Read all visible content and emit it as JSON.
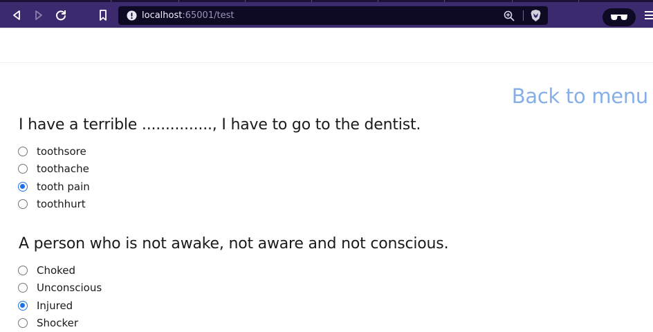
{
  "browser": {
    "url_host": "localhost",
    "url_rest": ":65001/test"
  },
  "page": {
    "back_link": "Back to menu",
    "questions": [
      {
        "text": "I have a terrible ..............., I have to go to the dentist.",
        "options": [
          {
            "label": "toothsore",
            "checked": false
          },
          {
            "label": "toothache",
            "checked": false
          },
          {
            "label": "tooth pain",
            "checked": true
          },
          {
            "label": "toothhurt",
            "checked": false
          }
        ]
      },
      {
        "text": "A person who is not awake, not aware and not conscious.",
        "options": [
          {
            "label": "Choked",
            "checked": false
          },
          {
            "label": "Unconscious",
            "checked": false
          },
          {
            "label": "Injured",
            "checked": true
          },
          {
            "label": "Shocker",
            "checked": false
          }
        ]
      }
    ]
  }
}
